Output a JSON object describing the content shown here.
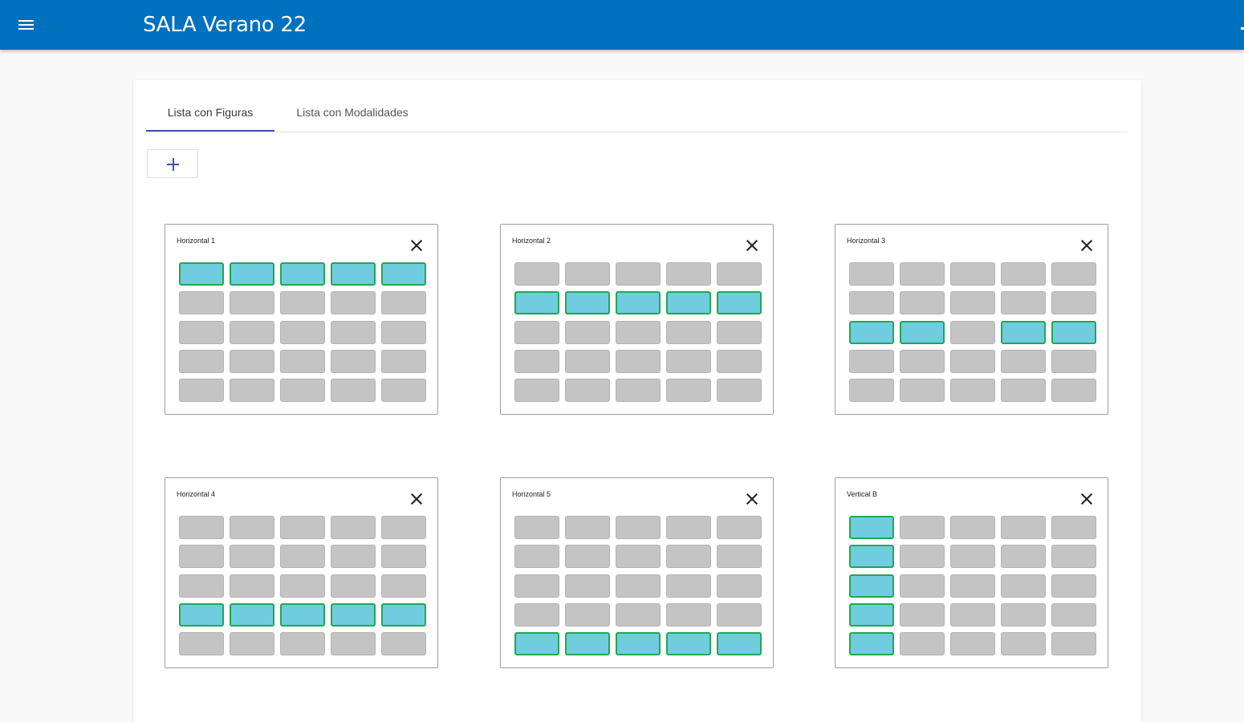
{
  "app": {
    "title": "SALA Verano 22"
  },
  "icons": {
    "menu": "menu-icon",
    "add": "plus-icon",
    "close": "close-icon"
  },
  "colors": {
    "appbar": "#0071be",
    "tab_indicator": "#3f51b5",
    "cell_marked": "#70cde0",
    "cell_marked_border": "#21a84f",
    "cell_empty": "#c4c4c4"
  },
  "tabs": [
    {
      "label": "Lista con Figuras",
      "active": true
    },
    {
      "label": "Lista con Modalidades",
      "active": false
    }
  ],
  "figures": [
    {
      "name": "Horizontal 1",
      "grid": [
        [
          1,
          1,
          1,
          1,
          1
        ],
        [
          0,
          0,
          0,
          0,
          0
        ],
        [
          0,
          0,
          0,
          0,
          0
        ],
        [
          0,
          0,
          0,
          0,
          0
        ],
        [
          0,
          0,
          0,
          0,
          0
        ]
      ]
    },
    {
      "name": "Horizontal 2",
      "grid": [
        [
          0,
          0,
          0,
          0,
          0
        ],
        [
          1,
          1,
          1,
          1,
          1
        ],
        [
          0,
          0,
          0,
          0,
          0
        ],
        [
          0,
          0,
          0,
          0,
          0
        ],
        [
          0,
          0,
          0,
          0,
          0
        ]
      ]
    },
    {
      "name": "Horizontal 3",
      "grid": [
        [
          0,
          0,
          0,
          0,
          0
        ],
        [
          0,
          0,
          0,
          0,
          0
        ],
        [
          1,
          1,
          0,
          1,
          1
        ],
        [
          0,
          0,
          0,
          0,
          0
        ],
        [
          0,
          0,
          0,
          0,
          0
        ]
      ]
    },
    {
      "name": "Horizontal 4",
      "grid": [
        [
          0,
          0,
          0,
          0,
          0
        ],
        [
          0,
          0,
          0,
          0,
          0
        ],
        [
          0,
          0,
          0,
          0,
          0
        ],
        [
          1,
          1,
          1,
          1,
          1
        ],
        [
          0,
          0,
          0,
          0,
          0
        ]
      ]
    },
    {
      "name": "Horizontal 5",
      "grid": [
        [
          0,
          0,
          0,
          0,
          0
        ],
        [
          0,
          0,
          0,
          0,
          0
        ],
        [
          0,
          0,
          0,
          0,
          0
        ],
        [
          0,
          0,
          0,
          0,
          0
        ],
        [
          1,
          1,
          1,
          1,
          1
        ]
      ]
    },
    {
      "name": "Vertical B",
      "grid": [
        [
          1,
          0,
          0,
          0,
          0
        ],
        [
          1,
          0,
          0,
          0,
          0
        ],
        [
          1,
          0,
          0,
          0,
          0
        ],
        [
          1,
          0,
          0,
          0,
          0
        ],
        [
          1,
          0,
          0,
          0,
          0
        ]
      ]
    }
  ]
}
